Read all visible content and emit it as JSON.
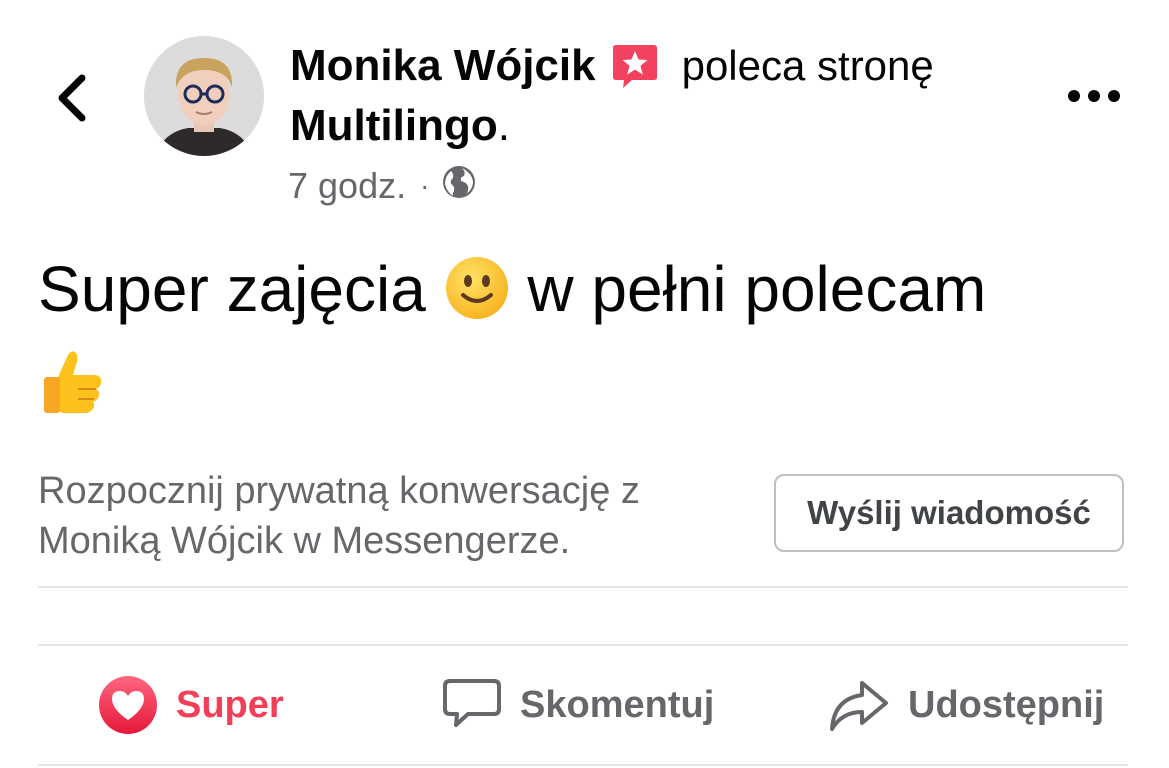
{
  "post": {
    "author_name": "Monika Wójcik",
    "action_text": "poleca stronę",
    "page_name": "Multilingo",
    "page_name_suffix": ".",
    "time": "7 godz.",
    "time_separator": "·",
    "privacy_icon": "globe-icon",
    "badge_icon": "recommendation-star-icon",
    "text_part1": "Super zajęcia",
    "text_part2": "w pełni polecam",
    "emojis": [
      "slightly-smiling-face",
      "thumbs-up"
    ]
  },
  "cta": {
    "text": "Rozpocznij prywatną konwersację z Moniką Wójcik w Messengerze.",
    "button_label": "Wyślij wiadomość"
  },
  "actions": {
    "like_label": "Super",
    "comment_label": "Skomentuj",
    "share_label": "Udostępnij"
  },
  "colors": {
    "like_active": "#f33e58",
    "secondary_text": "#65676b",
    "primary_text": "#050505",
    "badge": "#f3425f",
    "divider": "#e4e6eb"
  }
}
